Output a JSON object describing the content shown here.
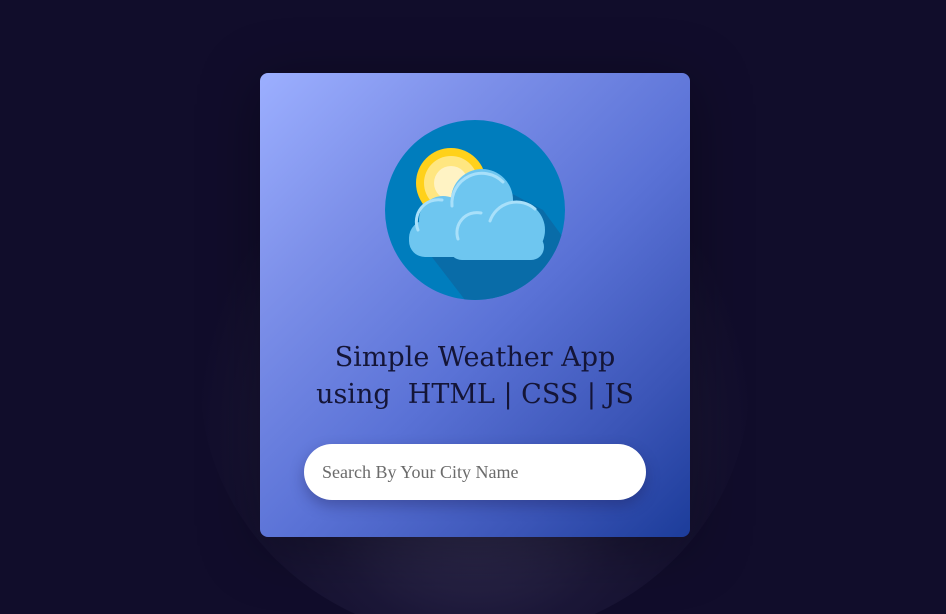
{
  "app": {
    "title_line1": "Simple Weather App",
    "title_line2": "using  HTML | CSS | JS",
    "logo_icon": "weather-sun-cloud-icon"
  },
  "search": {
    "placeholder": "Search By Your City Name",
    "value": ""
  },
  "colors": {
    "background": "#110d2b",
    "card_gradient_start": "#9cafff",
    "card_gradient_end": "#1c3c9a",
    "title_text": "#141537",
    "logo_circle": "#007dbd",
    "cloud": "#6ec6f0",
    "sun": "#ffd11a"
  }
}
